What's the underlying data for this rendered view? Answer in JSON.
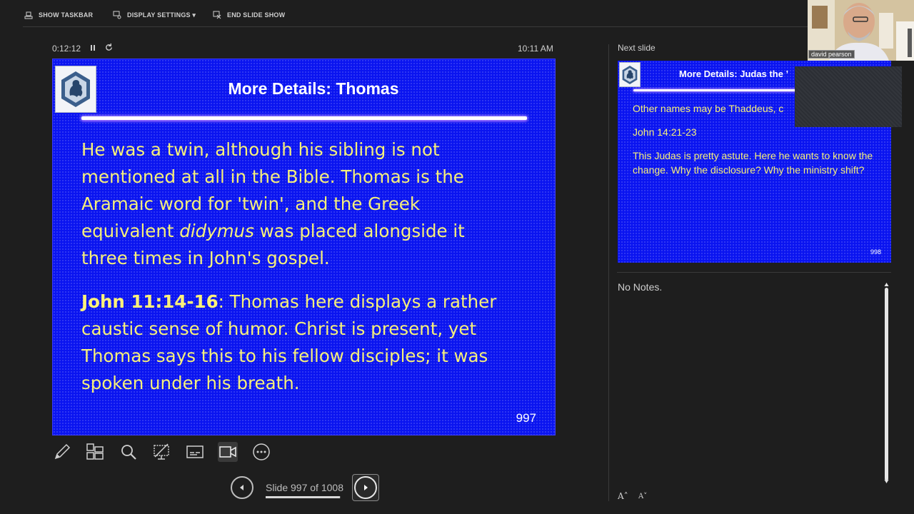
{
  "toolbar": {
    "show_taskbar": "SHOW TASKBAR",
    "display_settings": "DISPLAY SETTINGS ▾",
    "end_slide_show": "END SLIDE SHOW"
  },
  "timer": {
    "elapsed": "0:12:12",
    "clock": "10:11 AM"
  },
  "current_slide": {
    "title": "More Details: Thomas",
    "para1_line1": "He was a twin, although his sibling is not",
    "para1_line2": "mentioned at all in the Bible. Thomas is the",
    "para1_line3": "Aramaic word for 'twin', and the Greek",
    "para1_line4a": "equivalent ",
    "para1_line4b": "didymus",
    "para1_line4c": " was placed alongside it",
    "para1_line5": "three times in John's gospel.",
    "para2_ref": "John 11:14-16",
    "para2_line1": ": Thomas here displays a rather",
    "para2_line2": "caustic sense of humor. Christ is present, yet",
    "para2_line3": "Thomas says this to his fellow disciples; it was",
    "para2_line4": "spoken under his breath.",
    "number": "997"
  },
  "navigation": {
    "slide_count": "Slide 997 of 1008",
    "progress_fraction": 0.989
  },
  "next_slide": {
    "label": "Next slide",
    "title": "More Details: Judas the ’",
    "line1": "Other names may be Thaddeus, c",
    "line2": "John 14:21-23",
    "line3": "This Judas is pretty astute. Here he wants to know the change. Why the disclosure? Why the ministry shift?",
    "number": "998"
  },
  "notes": {
    "text": "No Notes."
  },
  "font_buttons": {
    "increase": "A˄",
    "decrease": "A˅"
  },
  "webcam": {
    "name": "david pearson"
  },
  "colors": {
    "slide_blue": "#0a14f0",
    "slide_text": "#f6f07a",
    "app_bg": "#1e1e1e"
  },
  "icons": [
    "taskbar-icon",
    "display-settings-icon",
    "end-show-icon",
    "pause-icon",
    "reset-icon",
    "pen-icon",
    "all-slides-icon",
    "zoom-icon",
    "pointer-icon",
    "subtitles-icon",
    "camera-icon",
    "more-icon",
    "prev-arrow-icon",
    "next-arrow-icon"
  ]
}
